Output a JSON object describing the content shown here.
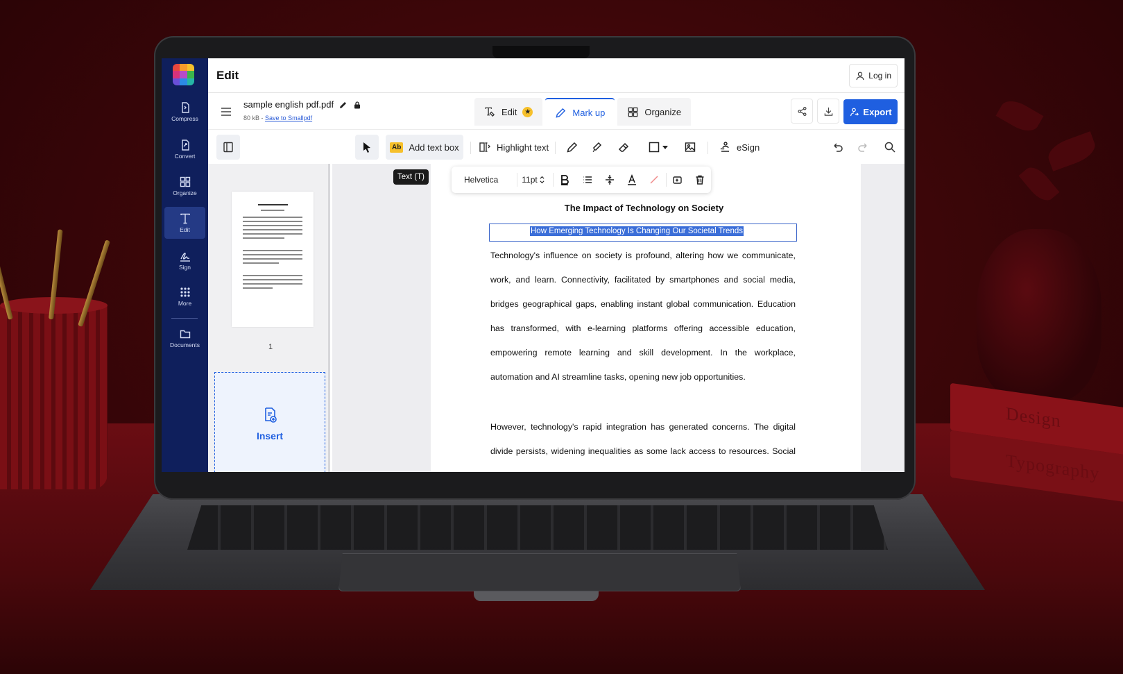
{
  "sidebar": {
    "items": [
      {
        "label": "Compress",
        "icon": "compress-icon"
      },
      {
        "label": "Convert",
        "icon": "convert-icon"
      },
      {
        "label": "Organize",
        "icon": "organize-icon"
      },
      {
        "label": "Edit",
        "icon": "edit-text-icon",
        "active": true
      },
      {
        "label": "Sign",
        "icon": "sign-icon"
      },
      {
        "label": "More",
        "icon": "grid-icon"
      },
      {
        "label": "Documents",
        "icon": "folder-icon"
      }
    ]
  },
  "header": {
    "title": "Edit",
    "login_label": "Log in"
  },
  "file": {
    "name": "sample english pdf.pdf",
    "size": "80 kB",
    "separator": "-",
    "save_link": "Save to Smallpdf"
  },
  "modes": {
    "edit_label": "Edit",
    "markup_label": "Mark up",
    "organize_label": "Organize",
    "active": "Mark up"
  },
  "actions": {
    "export_label": "Export"
  },
  "toolbar": {
    "add_text_box_icon_text": "Ab",
    "add_text_box_label": "Add text box",
    "highlight_label": "Highlight text",
    "esign_label": "eSign"
  },
  "tooltip": {
    "text": "Text (T)"
  },
  "format_bar": {
    "font": "Helvetica",
    "size": "11pt"
  },
  "thumbnails": {
    "page_number": "1",
    "insert_label": "Insert"
  },
  "document": {
    "title": "The Impact of Technology on Society",
    "subtitle": "How Emerging Technology Is Changing Our Societal Trends",
    "paragraph1": [
      "Technology's influence on society is profound, altering how we communicate,",
      "work, and learn. Connectivity, facilitated by smartphones and social media,",
      "bridges geographical gaps, enabling instant global communication. Education",
      "has transformed, with e-learning platforms offering accessible education,",
      "empowering remote learning and skill development. In the workplace,",
      "automation and AI streamline tasks, opening new job opportunities."
    ],
    "paragraph2": [
      "However, technology's rapid integration has generated concerns. The digital",
      "divide persists, widening inequalities as some lack access to resources. Social"
    ]
  },
  "colors": {
    "sidebar_bg": "#0f1f5c",
    "accent": "#1f5fe0",
    "highlight": "#3b6ed8",
    "star": "#f6c02b"
  }
}
